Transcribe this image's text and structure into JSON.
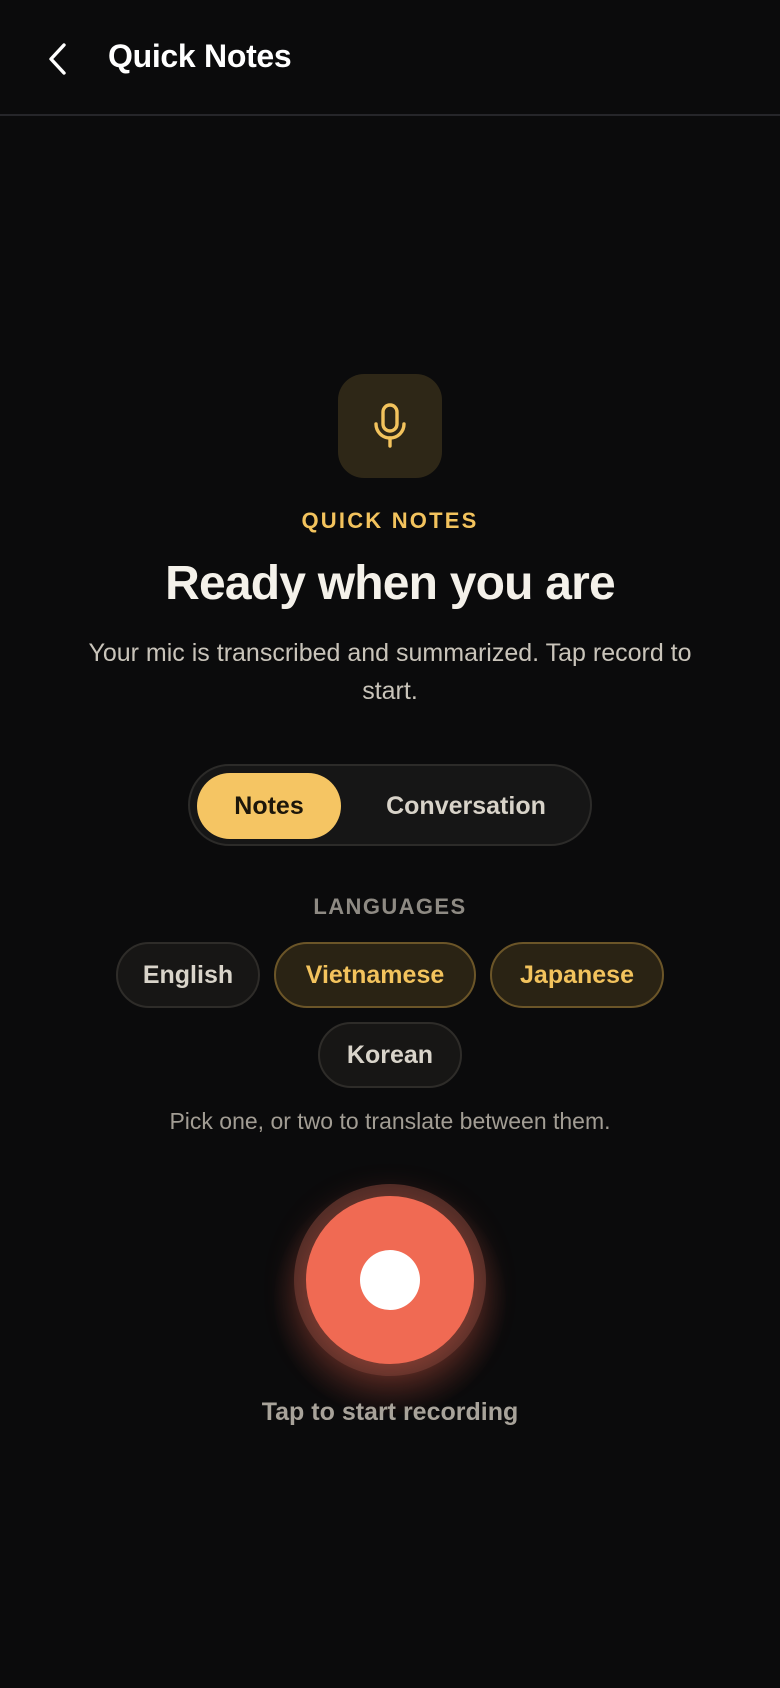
{
  "header": {
    "title": "Quick Notes",
    "back_icon": "chevron-left-icon"
  },
  "hero": {
    "icon": "microphone-icon",
    "eyebrow": "QUICK NOTES",
    "headline": "Ready when you are",
    "subtitle": "Your mic is transcribed and summarized. Tap record to start."
  },
  "mode_toggle": {
    "options": [
      {
        "label": "Notes",
        "selected": true
      },
      {
        "label": "Conversation",
        "selected": false
      }
    ]
  },
  "languages": {
    "label": "LANGUAGES",
    "chips": [
      {
        "label": "English",
        "selected": false
      },
      {
        "label": "Vietnamese",
        "selected": true
      },
      {
        "label": "Japanese",
        "selected": true
      },
      {
        "label": "Korean",
        "selected": false
      }
    ],
    "hint": "Pick one, or two to translate between them."
  },
  "record": {
    "caption": "Tap to start recording"
  },
  "colors": {
    "background": "#0b0b0c",
    "accent": "#f5c563",
    "record": "#f06a53"
  }
}
